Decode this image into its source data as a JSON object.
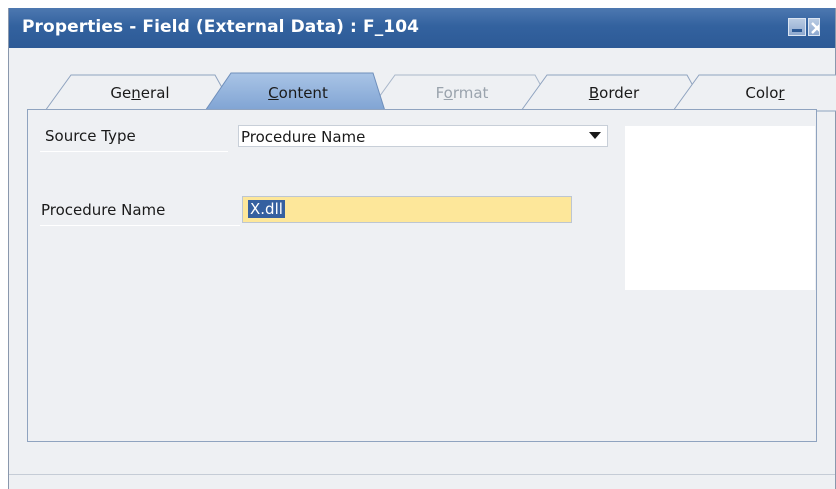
{
  "window": {
    "title": "Properties - Field (External Data) : F_104"
  },
  "tabs": [
    {
      "label_pre": "Ge",
      "label_u": "n",
      "label_post": "eral",
      "state": "normal"
    },
    {
      "label_pre": "",
      "label_u": "C",
      "label_post": "ontent",
      "state": "selected"
    },
    {
      "label_pre": "F",
      "label_u": "o",
      "label_post": "rmat",
      "state": "disabled"
    },
    {
      "label_pre": "",
      "label_u": "B",
      "label_post": "order",
      "state": "normal"
    },
    {
      "label_pre": "Colo",
      "label_u": "r",
      "label_post": "",
      "state": "normal"
    }
  ],
  "content": {
    "source_type_label": "Source Type",
    "source_type_value": "Procedure Name",
    "procedure_name_label": "Procedure Name",
    "procedure_name_value": "X.dll"
  },
  "colors": {
    "titlebar": "#33629f",
    "selected_tab": "#8eb0dc",
    "field_highlight": "#fde79a",
    "text_selection": "#3560a0"
  }
}
